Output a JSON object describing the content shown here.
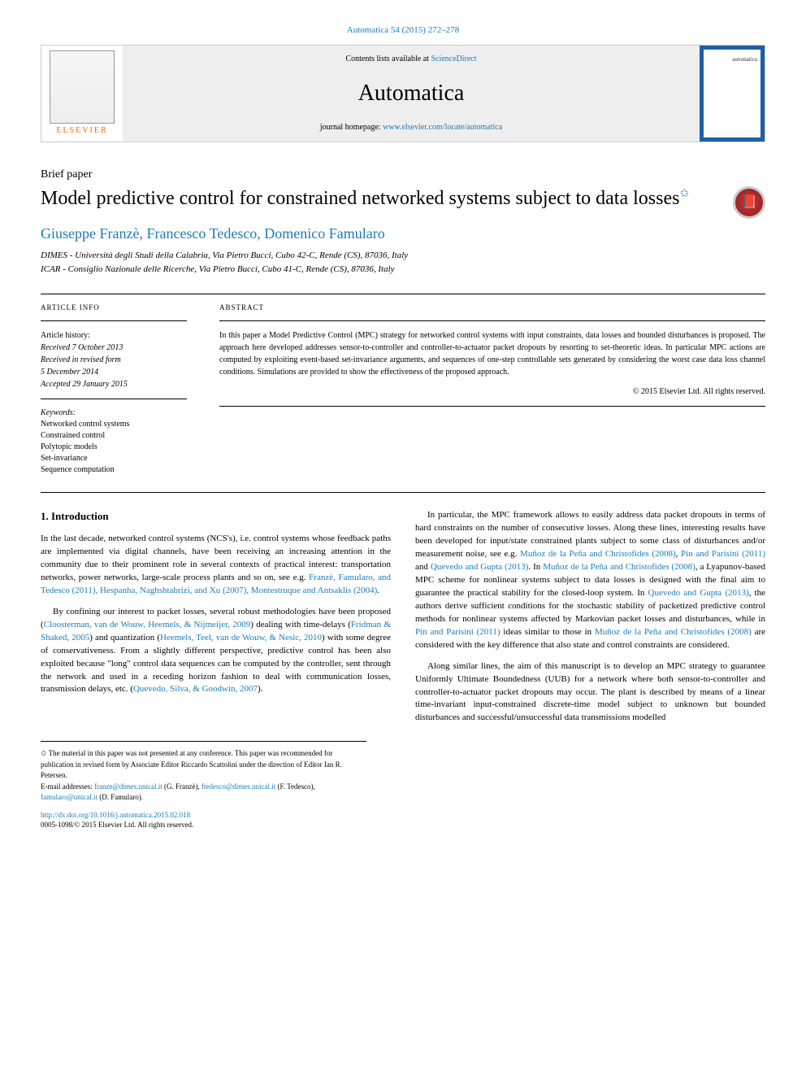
{
  "header": {
    "citation": "Automatica 54 (2015) 272–278",
    "contents_prefix": "Contents lists available at ",
    "contents_link": "ScienceDirect",
    "journal_name": "Automatica",
    "homepage_prefix": "journal homepage: ",
    "homepage_url": "www.elsevier.com/locate/automatica",
    "cover_label": "automatica",
    "elsevier_label": "ELSEVIER"
  },
  "paper": {
    "type": "Brief paper",
    "title": "Model predictive control for constrained networked systems subject to data losses",
    "superscript": "✩",
    "authors": "Giuseppe Franzè, Francesco Tedesco, Domenico Famularo",
    "affiliations": [
      "DIMES - Università degli Studi della Calabria, Via Pietro Bucci, Cubo 42-C, Rende (CS), 87036, Italy",
      "ICAR - Consiglio Nazionale delle Ricerche, Via Pietro Bucci, Cubo 41-C, Rende (CS), 87036, Italy"
    ]
  },
  "article_info": {
    "heading": "ARTICLE INFO",
    "history_label": "Article history:",
    "dates": [
      "Received 7 October 2013",
      "Received in revised form",
      "5 December 2014",
      "Accepted 29 January 2015"
    ],
    "keywords_label": "Keywords:",
    "keywords": [
      "Networked control systems",
      "Constrained control",
      "Polytopic models",
      "Set-invariance",
      "Sequence computation"
    ]
  },
  "abstract": {
    "heading": "ABSTRACT",
    "text": "In this paper a Model Predictive Control (MPC) strategy for networked control systems with input constraints, data losses and bounded disturbances is proposed. The approach here developed addresses sensor-to-controller and controller-to-actuator packet dropouts by resorting to set-theoretic ideas. In particular MPC actions are computed by exploiting event-based set-invariance arguments, and sequences of one-step controllable sets generated by considering the worst case data loss channel conditions. Simulations are provided to show the effectiveness of the proposed approach.",
    "copyright": "© 2015 Elsevier Ltd. All rights reserved."
  },
  "body": {
    "section_heading": "1. Introduction",
    "p1_a": "In the last decade, networked control systems (NCS's), i.e. control systems whose feedback paths are implemented via digital channels, have been receiving an increasing attention in the community due to their prominent role in several contexts of practical interest: transportation networks, power networks, large-scale process plants and so on, see e.g. ",
    "p1_links": "Franzè, Famularo, and Tedesco (2011), Hespanha, Naghshtabrizi, and Xu (2007), Montestruque and Antsaklis (2004)",
    "p1_b": ".",
    "p2_a": "By confining our interest to packet losses, several robust methodologies have been proposed (",
    "p2_link1": "Cloosterman, van de Wouw, Heemels, & Nijmeijer, 2009",
    "p2_b": ") dealing with time-delays (",
    "p2_link2": "Fridman & Shaked, 2005",
    "p2_c": ") and quantization (",
    "p2_link3": "Heemels, Teel, van de Wouw, & Nesic, 2010",
    "p2_d": ") with some degree of conservativeness. From a slightly different perspective, predictive control has been also exploited because \"long\" control data sequences can be computed by the controller, sent through the network and used in a receding horizon fashion to deal with communication losses, transmission delays, etc. (",
    "p2_link4": "Quevedo, Silva, & Goodwin, 2007",
    "p2_e": ").",
    "p3_a": "In particular, the MPC framework allows to easily address data packet dropouts in terms of hard constraints on the number of consecutive losses. Along these lines, interesting results have been developed for input/state constrained plants subject to some class of disturbances and/or measurement noise, see e.g. ",
    "p3_link1": "Muñoz de la Peña and Christofides (2008)",
    "p3_m1": ", ",
    "p3_link2": "Pin and Parisini (2011)",
    "p3_m2": " and ",
    "p3_link3": "Quevedo and Gupta (2013)",
    "p3_m3": ". In ",
    "p3_link4": "Muñoz de la Peña and Christofides (2008)",
    "p3_b": ", a Lyapunov-based MPC scheme for nonlinear systems subject to data losses is designed with the final aim to guarantee the practical stability for the closed-loop system. In ",
    "p3_link5": "Quevedo and Gupta (2013)",
    "p3_c": ", the authors derive sufficient conditions for the stochastic stability of packetized predictive control methods for nonlinear systems affected by Markovian packet losses and disturbances, while in ",
    "p3_link6": "Pin and Parisini (2011)",
    "p3_d": " ideas similar to those in ",
    "p3_link7": "Muñoz de la Peña and Christofides (2008)",
    "p3_e": " are considered with the key difference that also state and control constraints are considered.",
    "p4": "Along similar lines, the aim of this manuscript is to develop an MPC strategy to guarantee Uniformly Ultimate Boundedness (UUB) for a network where both sensor-to-controller and controller-to-actuator packet dropouts may occur. The plant is described by means of a linear time-invariant input-constrained discrete-time model subject to unknown but bounded disturbances and successful/unsuccessful data transmissions modelled"
  },
  "footnotes": {
    "note1": "✩ The material in this paper was not presented at any conference. This paper was recommended for publication in revised form by Associate Editor Riccardo Scattolini under the direction of Editor Ian R. Petersen.",
    "emails_prefix": "E-mail addresses: ",
    "email1": "franze@dimes.unical.it",
    "name1": " (G. Franzè), ",
    "email2": "ftedesco@dimes.unical.it",
    "name2": " (F. Tedesco), ",
    "email3": "famularo@unical.it",
    "name3": " (D. Famularo).",
    "doi": "http://dx.doi.org/10.1016/j.automatica.2015.02.018",
    "issn": "0005-1098/© 2015 Elsevier Ltd. All rights reserved."
  }
}
